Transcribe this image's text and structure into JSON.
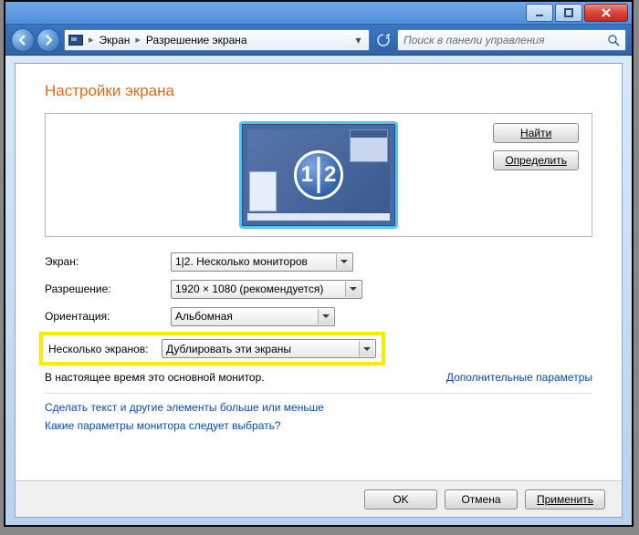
{
  "titlebar": {
    "minimize": "min",
    "maximize": "max",
    "close": "close"
  },
  "nav": {
    "crumb1": "Экран",
    "crumb2": "Разрешение экрана",
    "search_placeholder": "Поиск в панели управления"
  },
  "page": {
    "title": "Настройки экрана",
    "find_btn": "Найти",
    "detect_btn": "Определить",
    "monitor_n1": "1",
    "monitor_n2": "2",
    "labels": {
      "screen": "Экран:",
      "resolution": "Разрешение:",
      "orientation": "Ориентация:",
      "multimon": "Несколько экранов:"
    },
    "values": {
      "screen": "1|2. Несколько мониторов",
      "resolution": "1920 × 1080 (рекомендуется)",
      "orientation": "Альбомная",
      "multimon": "Дублировать эти экраны"
    },
    "primary_note": "В настоящее время это основной монитор.",
    "adv_link": "Дополнительные параметры",
    "link1": "Сделать текст и другие элементы больше или меньше",
    "link2": "Какие параметры монитора следует выбрать?"
  },
  "footer": {
    "ok": "OK",
    "cancel": "Отмена",
    "apply": "Применить"
  }
}
